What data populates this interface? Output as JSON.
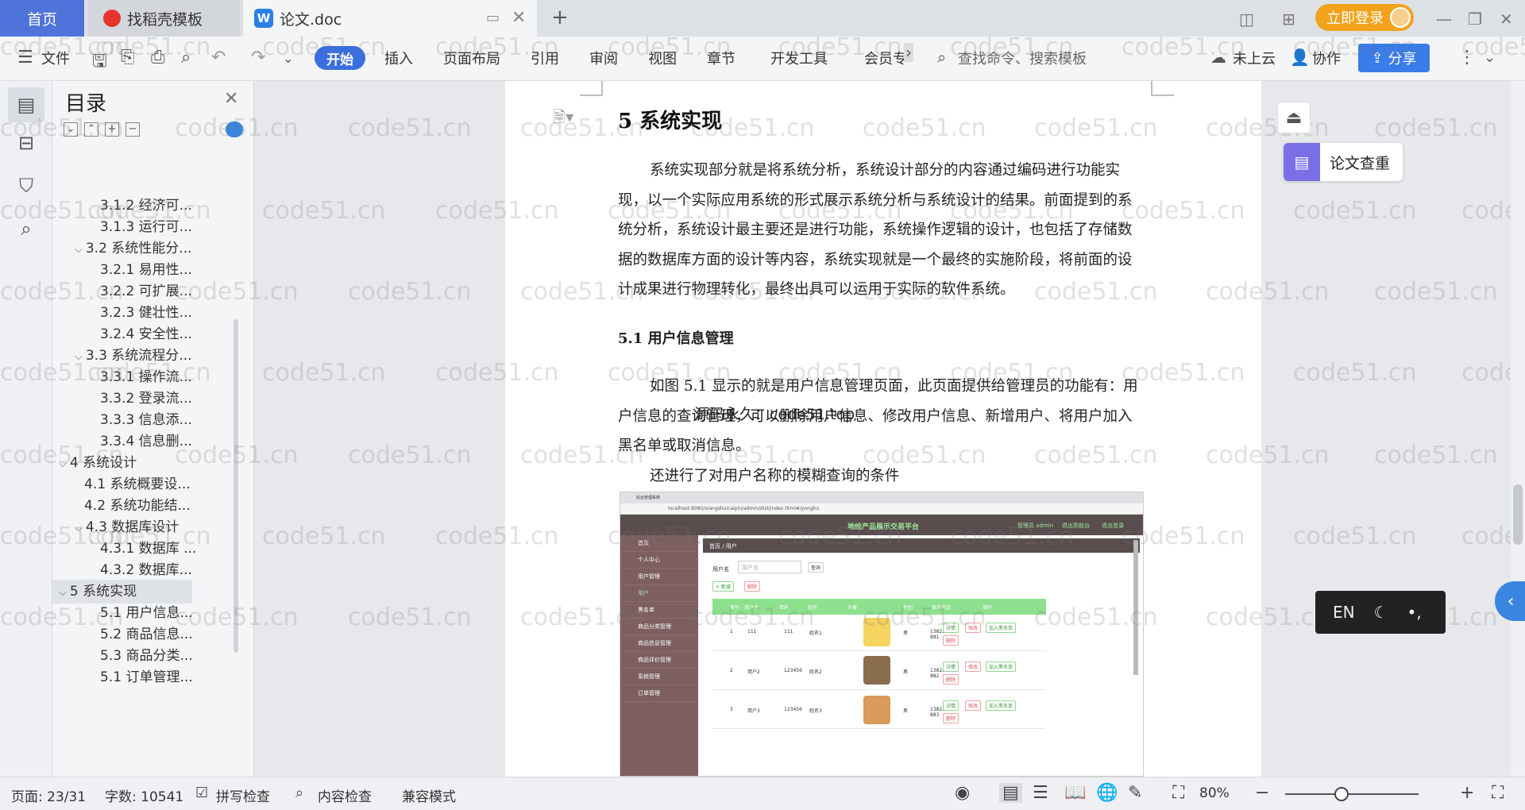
{
  "tabs": {
    "home": "首页",
    "daoke": "找稻壳模板",
    "doc": "论文.doc"
  },
  "topbar": {
    "login": "立即登录"
  },
  "ribbon": {
    "file": "文件",
    "items": [
      "开始",
      "插入",
      "页面布局",
      "引用",
      "审阅",
      "视图",
      "章节",
      "开发工具",
      "会员专"
    ],
    "search_placeholder": "查找命令、搜索模板",
    "cloud": "未上云",
    "collab": "协作",
    "share": "分享"
  },
  "toc": {
    "title": "目录",
    "items": [
      "3.1.2 经济可...",
      "3.1.3 运行可...",
      "3.2 系统性能分...",
      "3.2.1 易用性...",
      "3.2.2 可扩展...",
      "3.2.3 健壮性...",
      "3.2.4 安全性...",
      "3.3 系统流程分...",
      "3.3.1 操作流...",
      "3.3.2 登录流...",
      "3.3.3 信息添...",
      "3.3.4 信息删...",
      "4 系统设计",
      "4.1 系统概要设...",
      "4.2 系统功能结...",
      "4.3 数据库设计",
      "4.3.1 数据库 ...",
      "4.3.2 数据库...",
      "5 系统实现",
      "5.1 用户信息...",
      "5.2 商品信息...",
      "5.3 商品分类...",
      "5.1 订单管理..."
    ]
  },
  "document": {
    "heading": "5  系统实现",
    "para1_lines": [
      "系统实现部分就是将系统分析，系统设计部分的内容通过编码进行功能实",
      "现，以一个实际应用系统的形式展示系统分析与系统设计的结果。前面提到的系",
      "统分析，系统设计最主要还是进行功能，系统操作逻辑的设计，也包括了存储数",
      "据的数据库方面的设计等内容，系统实现就是一个最终的实施阶段，将前面的设",
      "计成果进行物理转化，最终出具可以运用于实际的软件系统。"
    ],
    "subheading": "5.1 用户信息管理",
    "para2_lines": [
      "如图 5.1 显示的就是用户信息管理页面，此页面提供给管理员的功能有：用",
      "户信息的查询管理，可以删除用户信息、修改用户信息、新增用户、将用户加入",
      "黑名单或取消信息。"
    ],
    "para3": "还进行了对用户名称的模糊查询的条件",
    "overlay": "源码永久：code51.top"
  },
  "screenshot": {
    "tab_title": "后台管理系统",
    "url": "localhost:8080/xiangshuicaipin/admin/dist/index.html#/yonghu",
    "app_title": "地绘产品展示交易平台",
    "header_right": [
      "管理员 admin",
      "退出到前台",
      "退出登录"
    ],
    "breadcrumb": "首页 / 用户",
    "menu": [
      "首页",
      "个人中心",
      "用户管理",
      "用户",
      "黑名单",
      "商品分类管理",
      "商品信息管理",
      "商品评价管理",
      "系统管理",
      "订单管理"
    ],
    "search_label": "用户名",
    "search_placeholder": "用户名",
    "query_btn": "查询",
    "add_btn": "+ 新增",
    "del_btn": "删除",
    "headers": [
      "",
      "索引",
      "用户名",
      "密码",
      "姓名",
      "头像",
      "性别",
      "联系电话",
      "操作"
    ],
    "rows": [
      [
        "1",
        "111",
        "111",
        "姓名1",
        "男",
        "13823888881"
      ],
      [
        "2",
        "用户2",
        "123456",
        "姓名2",
        "男",
        "13823888882"
      ],
      [
        "3",
        "用户3",
        "123456",
        "姓名3",
        "男",
        "13823888883"
      ]
    ],
    "ops": [
      "详情",
      "修改",
      "加入黑名单",
      "删除"
    ]
  },
  "right_panel": {
    "lunwen": "论文查重",
    "en": "EN"
  },
  "watermark": "code51.cn",
  "status": {
    "page": "页面: 23/31",
    "words": "字数: 10541",
    "spell": "拼写检查",
    "content": "内容检查",
    "compat": "兼容模式",
    "zoom": "80%"
  },
  "colors": {
    "accent": "#3a6fe0",
    "home_tab": "#4f74d9",
    "login": "#f2a21b",
    "shot_header": "#5a4d4d",
    "shot_menu": "#7d5f5f",
    "shot_table_header": "#8de08d"
  }
}
